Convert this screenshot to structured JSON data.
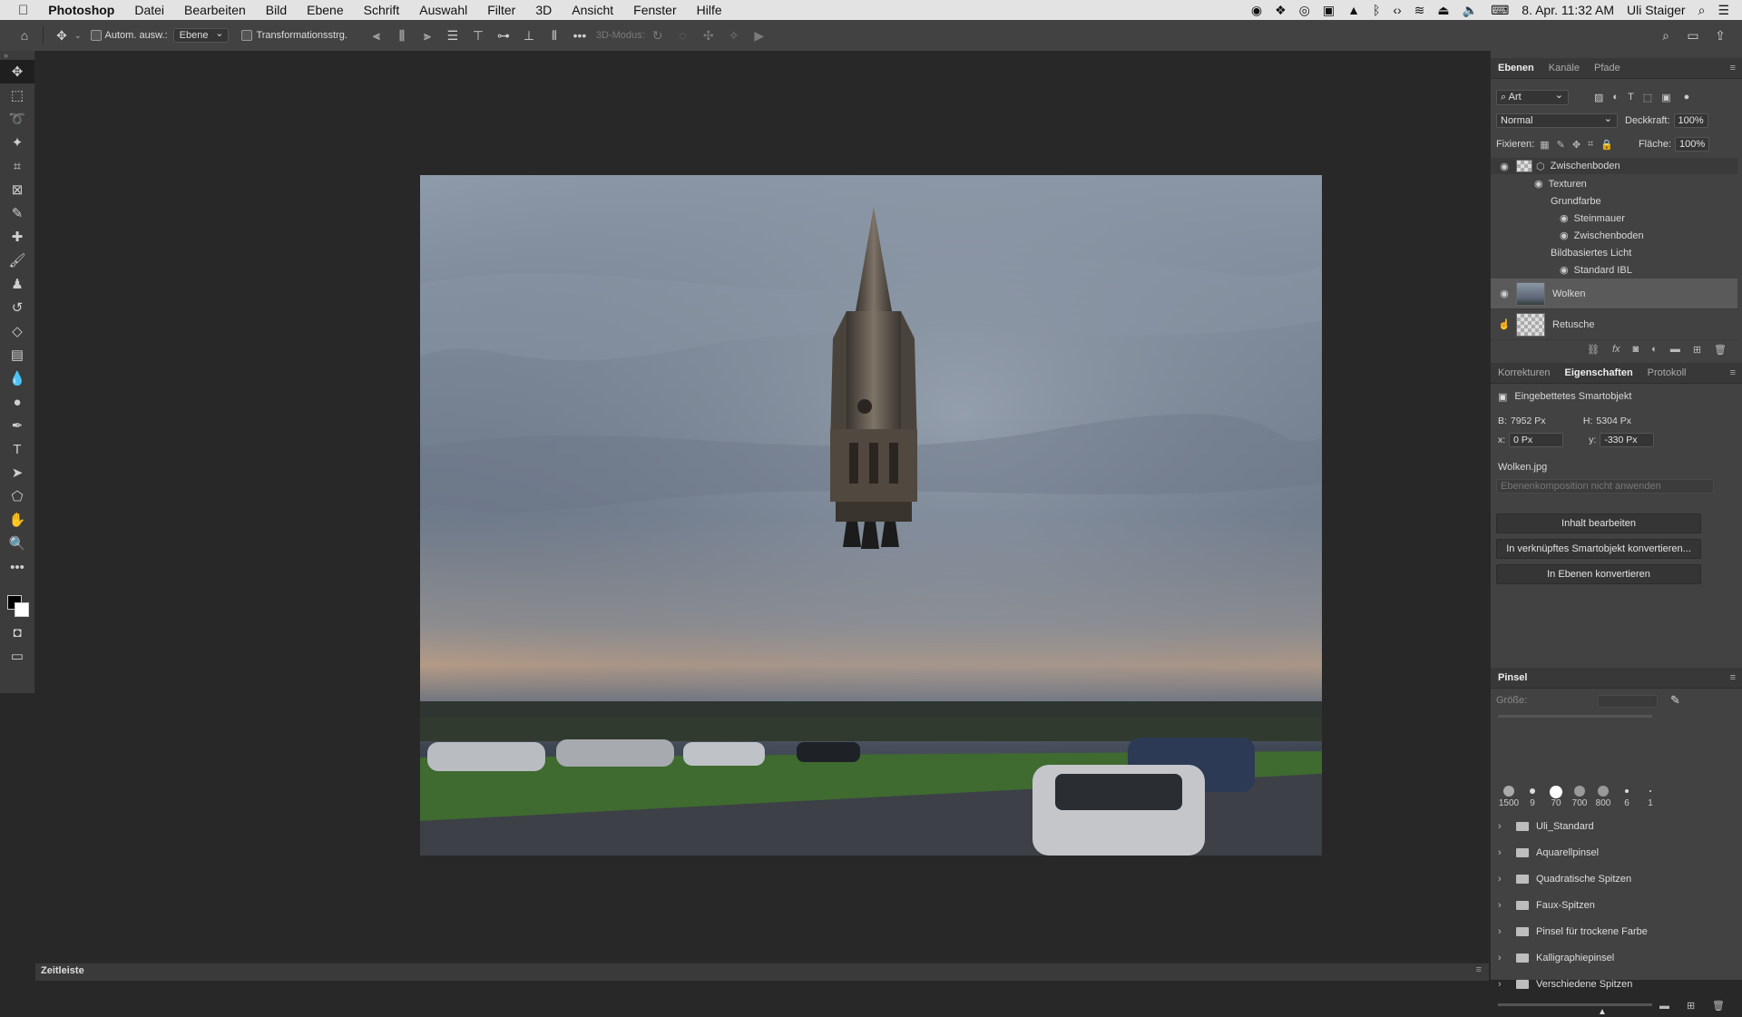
{
  "menubar": {
    "app": "Photoshop",
    "items": [
      "Datei",
      "Bearbeiten",
      "Bild",
      "Ebene",
      "Schrift",
      "Auswahl",
      "Filter",
      "3D",
      "Ansicht",
      "Fenster",
      "Hilfe"
    ],
    "datetime": "8. Apr. 11:32 AM",
    "user": "Uli Staiger"
  },
  "options": {
    "auto_select_label": "Autom. ausw.:",
    "auto_select_value": "Ebene",
    "transform_label": "Transformationsstrg.",
    "mode3d_label": "3D-Modus:"
  },
  "layers_panel": {
    "tabs": [
      "Ebenen",
      "Kanäle",
      "Pfade"
    ],
    "filter": "Art",
    "blend_mode": "Normal",
    "opacity_label": "Deckkraft:",
    "opacity_value": "100%",
    "lock_label": "Fixieren:",
    "fill_label": "Fläche:",
    "fill_value": "100%",
    "layers": [
      {
        "name": "Zwischenboden",
        "level": 0
      },
      {
        "name": "Texturen",
        "level": 1
      },
      {
        "name": "Grundfarbe",
        "level": 2
      },
      {
        "name": "Steinmauer",
        "level": 3
      },
      {
        "name": "Zwischenboden",
        "level": 3
      },
      {
        "name": "Bildbasiertes Licht",
        "level": 2
      },
      {
        "name": "Standard IBL",
        "level": 3
      },
      {
        "name": "Wolken",
        "level": 0,
        "selected": true
      },
      {
        "name": "Retusche",
        "level": 0
      }
    ]
  },
  "properties_panel": {
    "tabs": [
      "Korrekturen",
      "Eigenschaften",
      "Protokoll"
    ],
    "type": "Eingebettetes Smartobjekt",
    "b_label": "B:",
    "b_value": "7952 Px",
    "h_label": "H:",
    "h_value": "5304 Px",
    "x_label": "x:",
    "x_value": "0 Px",
    "y_label": "y:",
    "y_value": "-330 Px",
    "filename": "Wolken.jpg",
    "comp_placeholder": "Ebenenkomposition nicht anwenden",
    "buttons": [
      "Inhalt bearbeiten",
      "In verknüpftes Smartobjekt konvertieren...",
      "In Ebenen konvertieren"
    ]
  },
  "brush_panel": {
    "title": "Pinsel",
    "size_label": "Größe:",
    "presets": [
      "1500",
      "9",
      "70",
      "700",
      "800",
      "6",
      "1"
    ],
    "folders": [
      "Uli_Standard",
      "Aquarellpinsel",
      "Quadratische Spitzen",
      "Faux-Spitzen",
      "Pinsel für trockene Farbe",
      "Kalligraphiepinsel",
      "Verschiedene Spitzen"
    ]
  },
  "statusbar": {
    "timeline": "Zeitleiste"
  }
}
